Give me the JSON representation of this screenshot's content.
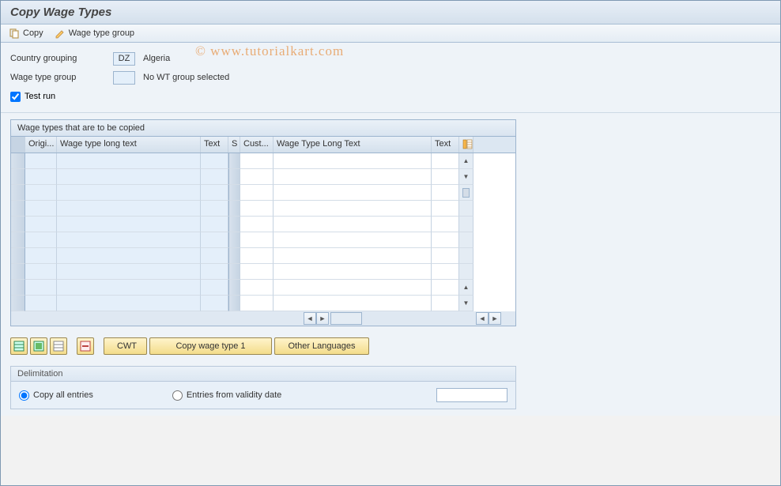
{
  "title": "Copy Wage Types",
  "toolbar": {
    "copy_label": "Copy",
    "wtg_label": "Wage type group"
  },
  "form": {
    "country_grouping_label": "Country grouping",
    "country_grouping_value": "DZ",
    "country_grouping_desc": "Algeria",
    "wage_type_group_label": "Wage type group",
    "wage_type_group_value": "",
    "wage_type_group_desc": "No WT group selected",
    "test_run_label": "Test run",
    "test_run_checked": true
  },
  "grid": {
    "title": "Wage types that are to be copied",
    "columns": {
      "origi": "Origi...",
      "wtlt1": "Wage type long text",
      "text1": "Text",
      "s": "S",
      "cust": "Cust...",
      "wtlt2": "Wage Type Long Text",
      "text2": "Text"
    },
    "row_count": 10
  },
  "buttons": {
    "cwt": "CWT",
    "copy_wt1": "Copy wage type 1",
    "other_lang": "Other Languages"
  },
  "delimitation": {
    "title": "Delimitation",
    "copy_all": "Copy all entries",
    "entries_from": "Entries from validity date",
    "selected": "copy_all",
    "date_value": ""
  },
  "watermark": "© www.tutorialkart.com"
}
